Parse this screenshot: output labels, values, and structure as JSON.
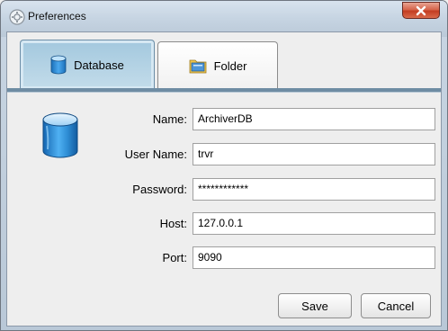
{
  "window": {
    "title": "Preferences"
  },
  "tabs": [
    {
      "label": "Database",
      "icon": "database-icon",
      "selected": true
    },
    {
      "label": "Folder",
      "icon": "folder-icon",
      "selected": false
    }
  ],
  "form": {
    "fields": [
      {
        "label": "Name:",
        "value": "ArchiverDB"
      },
      {
        "label": "User Name:",
        "value": "trvr"
      },
      {
        "label": "Password:",
        "value": "************"
      },
      {
        "label": "Host:",
        "value": "127.0.0.1"
      },
      {
        "label": "Port:",
        "value": "9090"
      }
    ]
  },
  "buttons": {
    "save": "Save",
    "cancel": "Cancel"
  },
  "colors": {
    "active_tab": "#a3c8de",
    "close_button": "#c33d22",
    "database_icon": "#2f8fd6"
  }
}
